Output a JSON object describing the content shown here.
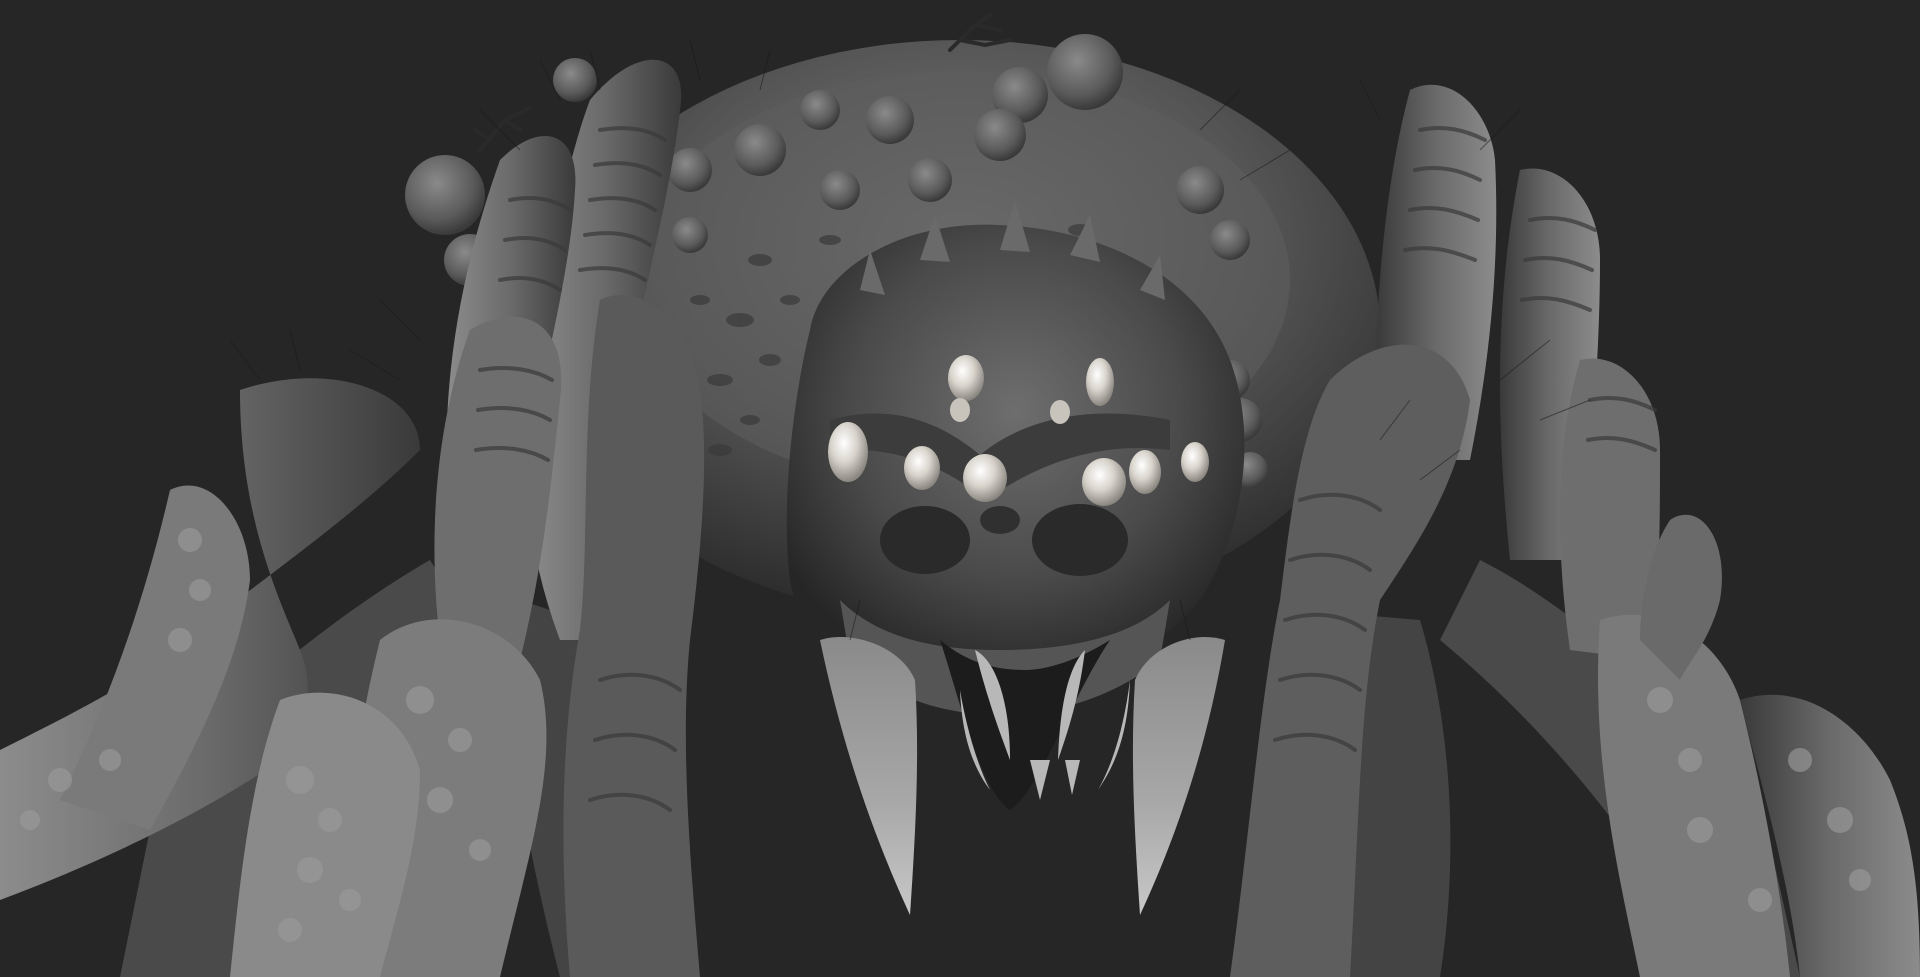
{
  "scene": {
    "subject": "spider-creature-sculpt",
    "colors": {
      "background": "#262626",
      "body": "#5c5c5c",
      "body_light": "#8e8e8e",
      "body_dark": "#2f2f2f",
      "eye": "#e8e4dc",
      "fang": "#9a9a9a",
      "hair": "#1a1a1a"
    },
    "eye_count": 10,
    "fang_count": 2,
    "leg_count": 8
  }
}
